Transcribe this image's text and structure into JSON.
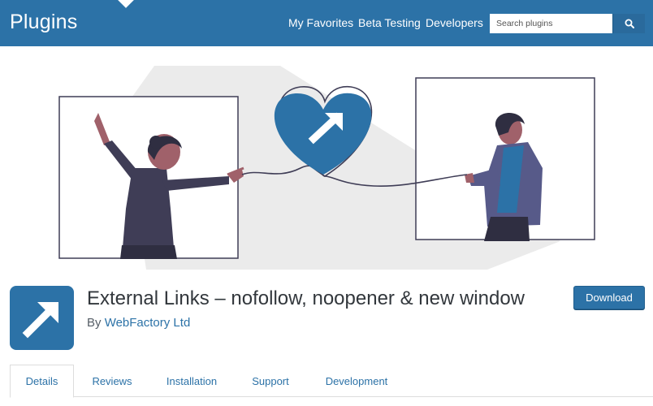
{
  "header": {
    "title": "Plugins",
    "nav": [
      "My Favorites",
      "Beta Testing",
      "Developers"
    ],
    "search_placeholder": "Search plugins",
    "search_icon": "search-icon"
  },
  "plugin": {
    "name": "External Links – nofollow, noopener & new window",
    "by_label": "By",
    "author": "WebFactory Ltd",
    "download_label": "Download",
    "icon": "arrow-up-right-icon"
  },
  "tabs": [
    "Details",
    "Reviews",
    "Installation",
    "Support",
    "Development"
  ],
  "active_tab": "Details",
  "colors": {
    "brand": "#2c72a7",
    "text": "#32373c",
    "banner_shape": "#ebebeb",
    "figure_dark": "#3f3d56",
    "figure_skin": "#a0616a"
  }
}
